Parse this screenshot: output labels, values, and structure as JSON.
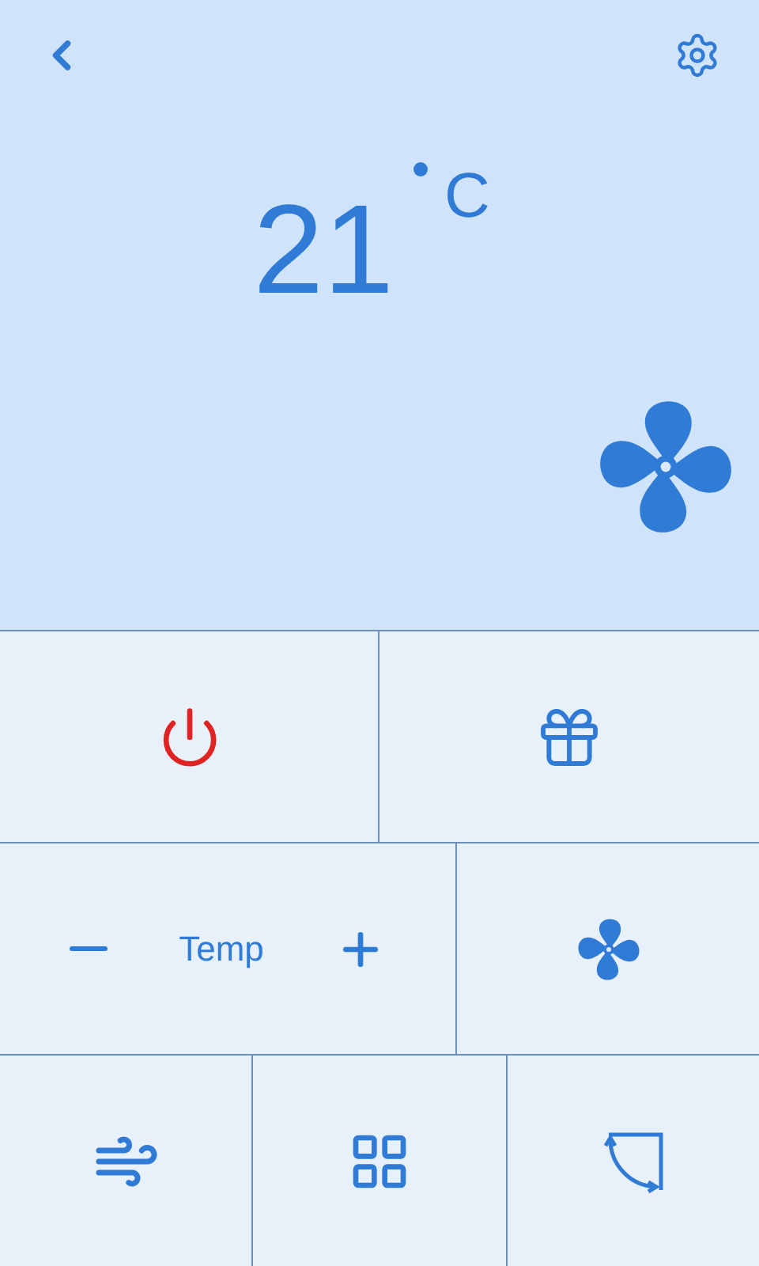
{
  "display": {
    "temperature": "21",
    "unit": "C"
  },
  "controls": {
    "temp_label": "Temp"
  }
}
